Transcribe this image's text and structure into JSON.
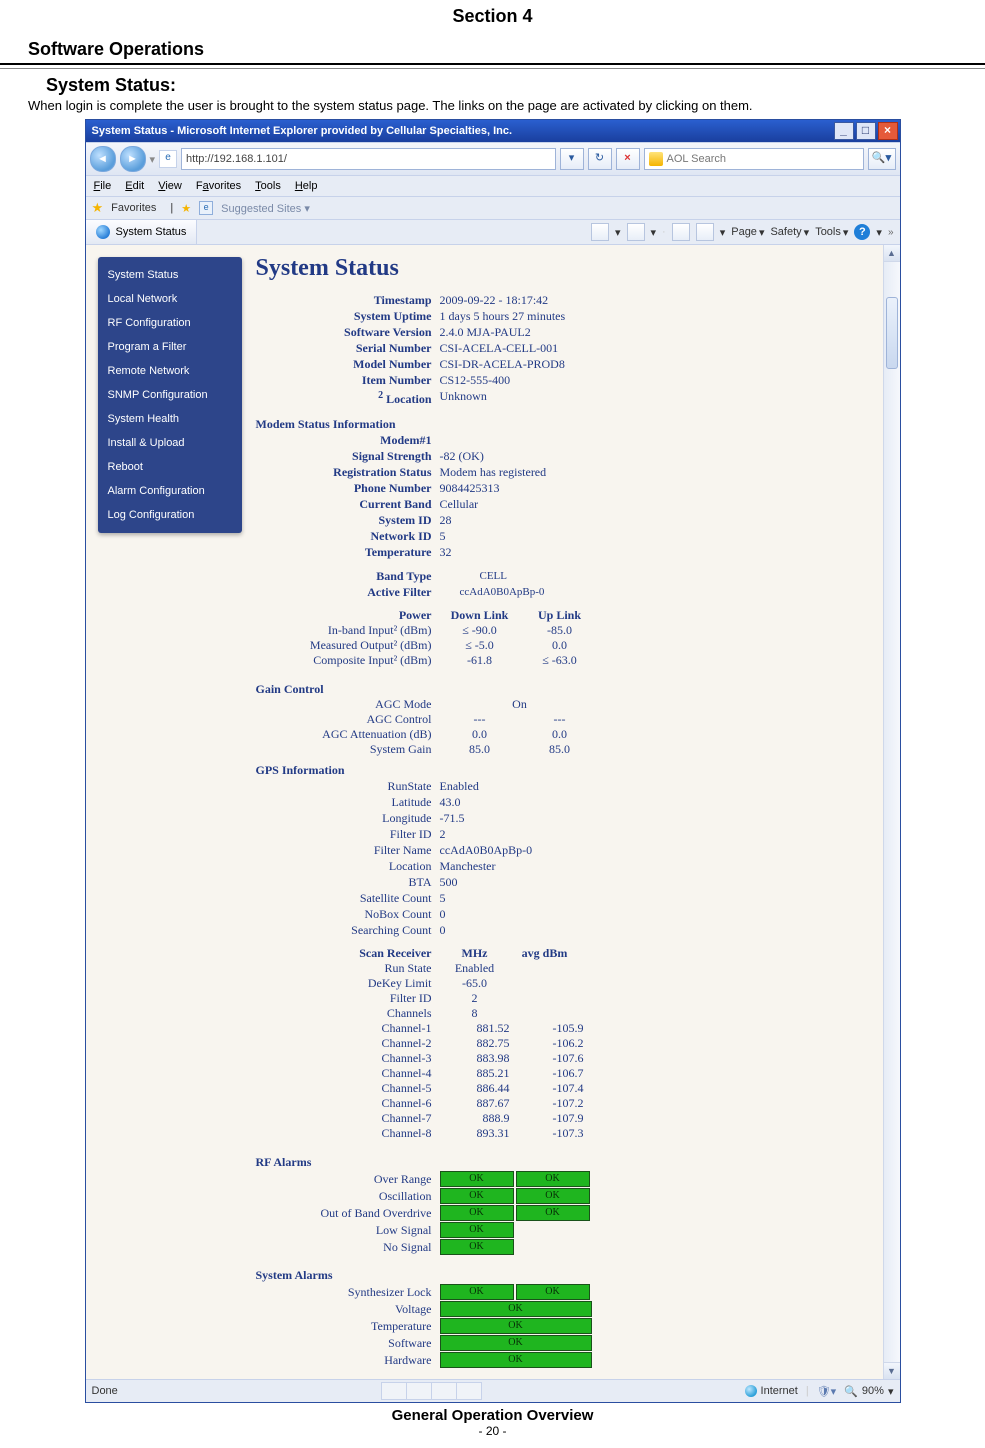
{
  "doc": {
    "section_title": "Section 4",
    "ops_heading": "Software Operations",
    "sub_heading": "System Status:",
    "intro": "When login is complete the user is brought to the system status page. The links on the page are activated by clicking on them.",
    "footer_title": "General Operation Overview",
    "footer_page": "- 20 -"
  },
  "browser": {
    "title": "System Status - Microsoft Internet Explorer provided by Cellular Specialties, Inc.",
    "url": "http://192.168.1.101/",
    "search_placeholder": "AOL Search",
    "menus": {
      "file": "File",
      "edit": "Edit",
      "view": "View",
      "favorites": "Favorites",
      "tools": "Tools",
      "help": "Help"
    },
    "favbar_label": "Favorites",
    "suggested": "Suggested Sites",
    "tab_label": "System Status",
    "toolbar": {
      "page": "Page",
      "safety": "Safety",
      "tools": "Tools"
    },
    "status_done": "Done",
    "status_zone": "Internet",
    "zoom": "90%"
  },
  "sidebar": {
    "items": [
      "System Status",
      "Local Network",
      "RF Configuration",
      "Program a Filter",
      "Remote Network",
      "SNMP Configuration",
      "System Health",
      "Install & Upload",
      "Reboot",
      "Alarm Configuration",
      "Log Configuration"
    ]
  },
  "status": {
    "h1": "System Status",
    "info_labels": {
      "timestamp": "Timestamp",
      "uptime": "System Uptime",
      "swver": "Software Version",
      "serial": "Serial Number",
      "model": "Model Number",
      "item": "Item Number",
      "loc": "Location"
    },
    "info": {
      "timestamp": "2009-09-22 - 18:17:42",
      "uptime": "1 days 5 hours 27 minutes",
      "swver": "2.4.0 MJA-PAUL2",
      "serial": "CSI-ACELA-CELL-001",
      "model": "CSI-DR-ACELA-PROD8",
      "item": "CS12-555-400",
      "loc": "Unknown"
    },
    "modem_title": "Modem Status Information",
    "modem_sub": "Modem#1",
    "modem_labels": {
      "signal": "Signal Strength",
      "reg": "Registration Status",
      "phone": "Phone Number",
      "band": "Current Band",
      "sysid": "System ID",
      "netid": "Network ID",
      "temp": "Temperature"
    },
    "modem": {
      "signal": "-82 (OK)",
      "reg": "Modem has registered",
      "phone": "9084425313",
      "band": "Cellular",
      "sysid": "28",
      "netid": "5",
      "temp": "32"
    },
    "bandtype_lbl": "Band Type",
    "bandtype": "CELL",
    "activefilter_lbl": "Active Filter",
    "activefilter": "ccAdA0B0ApBp-0",
    "power": {
      "title": "Power",
      "down": "Down Link",
      "up": "Up Link",
      "rows": [
        {
          "label": "In-band Input² (dBm)",
          "down": "≤ -90.0",
          "up": "-85.0"
        },
        {
          "label": "Measured Output² (dBm)",
          "down": "≤ -5.0",
          "up": "0.0"
        },
        {
          "label": "Composite Input² (dBm)",
          "down": "-61.8",
          "up": "≤ -63.0"
        }
      ]
    },
    "gain": {
      "title": "Gain Control",
      "rows": [
        {
          "label": "AGC Mode",
          "down": "On",
          "up": ""
        },
        {
          "label": "AGC Control",
          "down": "---",
          "up": "---"
        },
        {
          "label": "AGC Attenuation (dB)",
          "down": "0.0",
          "up": "0.0"
        },
        {
          "label": "System Gain",
          "down": "85.0",
          "up": "85.0"
        }
      ]
    },
    "gps": {
      "title": "GPS Information",
      "rows": [
        {
          "label": "RunState",
          "val": "Enabled"
        },
        {
          "label": "Latitude",
          "val": "43.0"
        },
        {
          "label": "Longitude",
          "val": "-71.5"
        },
        {
          "label": "Filter ID",
          "val": "2"
        },
        {
          "label": "Filter Name",
          "val": "ccAdA0B0ApBp-0"
        },
        {
          "label": "Location",
          "val": "Manchester"
        },
        {
          "label": "BTA",
          "val": "500"
        },
        {
          "label": "Satellite Count",
          "val": "5"
        },
        {
          "label": "NoBox Count",
          "val": "0"
        },
        {
          "label": "Searching Count",
          "val": "0"
        }
      ]
    },
    "scan": {
      "title": "Scan Receiver",
      "h2": "MHz",
      "h3": "avg dBm",
      "top": [
        {
          "label": "Run State",
          "c2": "Enabled",
          "c3": ""
        },
        {
          "label": "DeKey Limit",
          "c2": "-65.0",
          "c3": ""
        },
        {
          "label": "Filter ID",
          "c2": "2",
          "c3": ""
        },
        {
          "label": "Channels",
          "c2": "8",
          "c3": ""
        }
      ],
      "channels": [
        {
          "label": "Channel-1",
          "mhz": "881.52",
          "dbm": "-105.9"
        },
        {
          "label": "Channel-2",
          "mhz": "882.75",
          "dbm": "-106.2"
        },
        {
          "label": "Channel-3",
          "mhz": "883.98",
          "dbm": "-107.6"
        },
        {
          "label": "Channel-4",
          "mhz": "885.21",
          "dbm": "-106.7"
        },
        {
          "label": "Channel-5",
          "mhz": "886.44",
          "dbm": "-107.4"
        },
        {
          "label": "Channel-6",
          "mhz": "887.67",
          "dbm": "-107.2"
        },
        {
          "label": "Channel-7",
          "mhz": "888.9",
          "dbm": "-107.9"
        },
        {
          "label": "Channel-8",
          "mhz": "893.31",
          "dbm": "-107.3"
        }
      ]
    },
    "rf_alarms": {
      "title": "RF Alarms",
      "rows": [
        {
          "label": "Over Range",
          "a": "OK",
          "b": "OK"
        },
        {
          "label": "Oscillation",
          "a": "OK",
          "b": "OK"
        },
        {
          "label": "Out of Band Overdrive",
          "a": "OK",
          "b": "OK"
        },
        {
          "label": "Low Signal",
          "a": "OK",
          "b": ""
        },
        {
          "label": "No Signal",
          "a": "OK",
          "b": ""
        }
      ]
    },
    "sys_alarms": {
      "title": "System Alarms",
      "rows": [
        {
          "label": "Synthesizer Lock",
          "a": "OK",
          "b": "OK",
          "wide": false
        },
        {
          "label": "Voltage",
          "a": "OK",
          "b": "",
          "wide": true
        },
        {
          "label": "Temperature",
          "a": "OK",
          "b": "",
          "wide": true
        },
        {
          "label": "Software",
          "a": "OK",
          "b": "",
          "wide": true
        },
        {
          "label": "Hardware",
          "a": "OK",
          "b": "",
          "wide": true
        }
      ]
    }
  }
}
